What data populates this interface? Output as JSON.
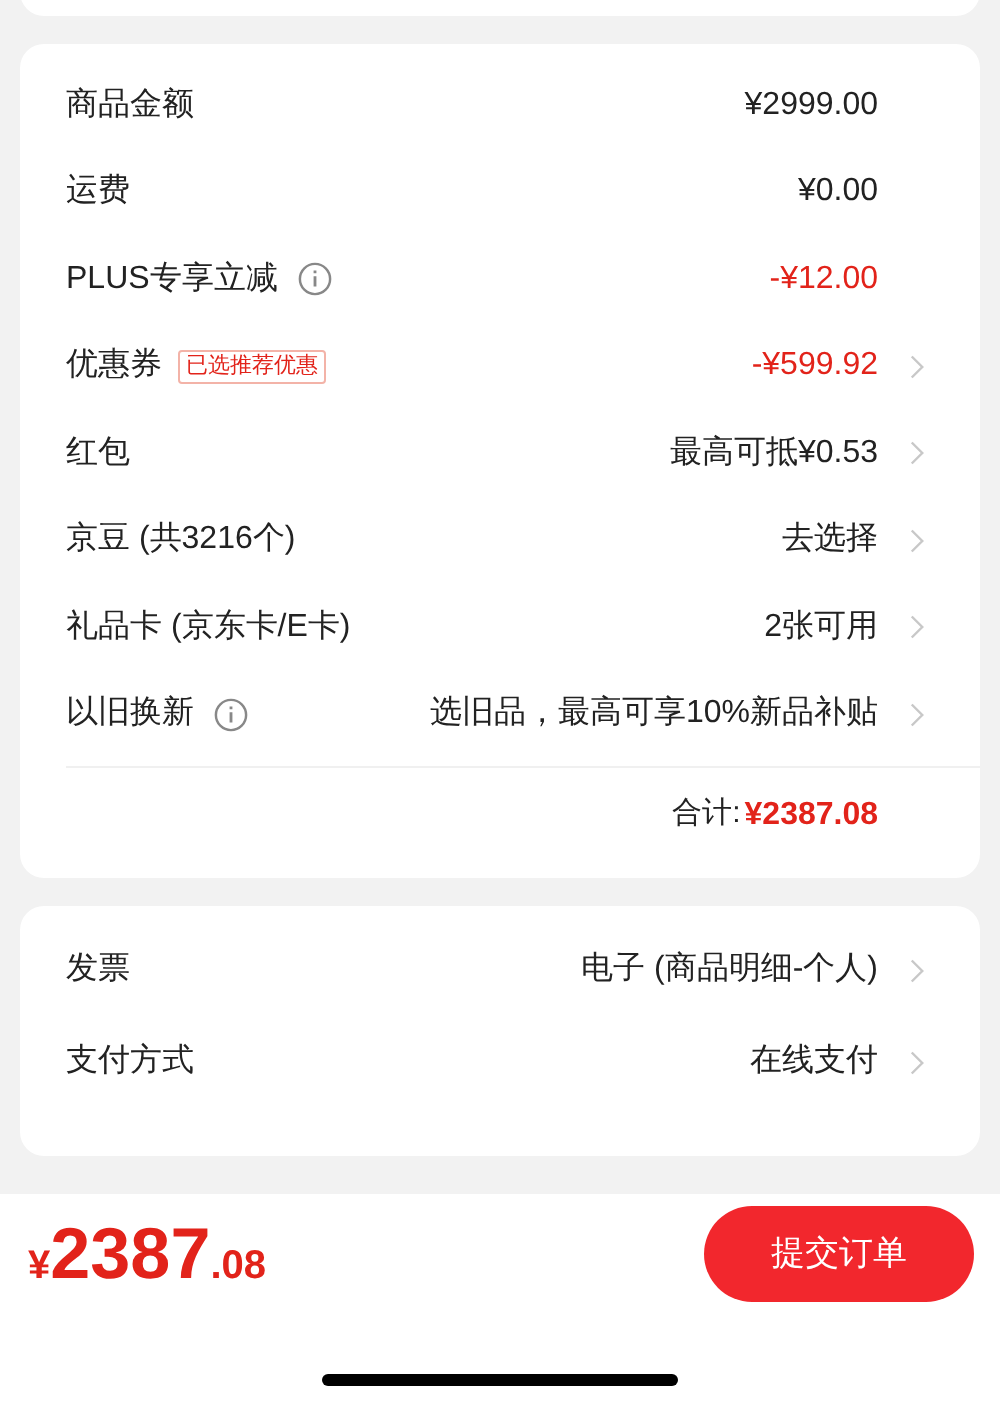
{
  "summary": {
    "rows": [
      {
        "label": "商品金额",
        "info": false,
        "value": "¥2999.00",
        "negative": false,
        "chevron": false
      },
      {
        "label": "运费",
        "info": false,
        "value": "¥0.00",
        "negative": false,
        "chevron": false
      },
      {
        "label": "PLUS专享立减",
        "info": true,
        "value": "-¥12.00",
        "negative": true,
        "chevron": false
      },
      {
        "label": "优惠券",
        "info": false,
        "tag": "已选推荐优惠",
        "value": "-¥599.92",
        "negative": true,
        "chevron": true
      },
      {
        "label": "红包",
        "info": false,
        "value": "最高可抵¥0.53",
        "negative": false,
        "chevron": true
      },
      {
        "label": "京豆 (共3216个)",
        "info": false,
        "value": "去选择",
        "negative": false,
        "chevron": true
      },
      {
        "label": "礼品卡 (京东卡/E卡)",
        "info": false,
        "value": "2张可用",
        "negative": false,
        "chevron": true
      },
      {
        "label": "以旧换新",
        "info": true,
        "value": "选旧品，最高可享10%新品补贴",
        "negative": false,
        "chevron": true
      }
    ],
    "total": {
      "label": "合计:",
      "amount": "¥2387.08"
    }
  },
  "options": {
    "rows": [
      {
        "label": "发票",
        "value": "电子 (商品明细-个人)",
        "chevron": true
      },
      {
        "label": "支付方式",
        "value": "在线支付",
        "chevron": true
      }
    ]
  },
  "footer": {
    "currency": "¥",
    "price_integer": "2387",
    "price_decimal": ".08",
    "submit_button": "提交订单"
  }
}
